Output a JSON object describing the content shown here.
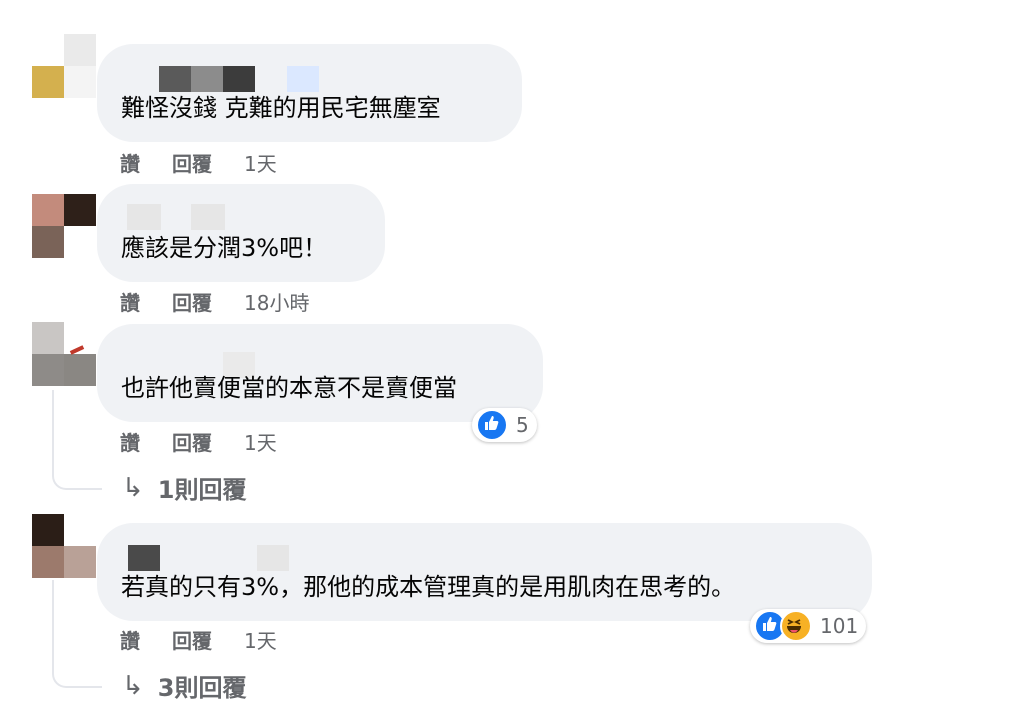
{
  "comments": [
    {
      "text": "難怪沒錢 克難的用民宅無塵室",
      "actions": {
        "like": "讚",
        "reply": "回覆"
      },
      "time": "1天"
    },
    {
      "text": "應該是分潤3%吧！",
      "actions": {
        "like": "讚",
        "reply": "回覆"
      },
      "time": "18小時"
    },
    {
      "text": "也許他賣便當的本意不是賣便當",
      "actions": {
        "like": "讚",
        "reply": "回覆"
      },
      "time": "1天",
      "reactions": {
        "icons": [
          "like-icon"
        ],
        "count": "5"
      },
      "replies_label": "1則回覆"
    },
    {
      "text": "若真的只有3%，那他的成本管理真的是用肌肉在思考的。",
      "actions": {
        "like": "讚",
        "reply": "回覆"
      },
      "time": "1天",
      "reactions": {
        "icons": [
          "like-icon",
          "haha-icon"
        ],
        "count": "101"
      },
      "replies_label": "3則回覆"
    }
  ],
  "colors": {
    "bubble": "#f0f2f5",
    "meta_text": "#65676b",
    "like_blue": "#1877f2",
    "haha_yellow": "#f7b125"
  }
}
